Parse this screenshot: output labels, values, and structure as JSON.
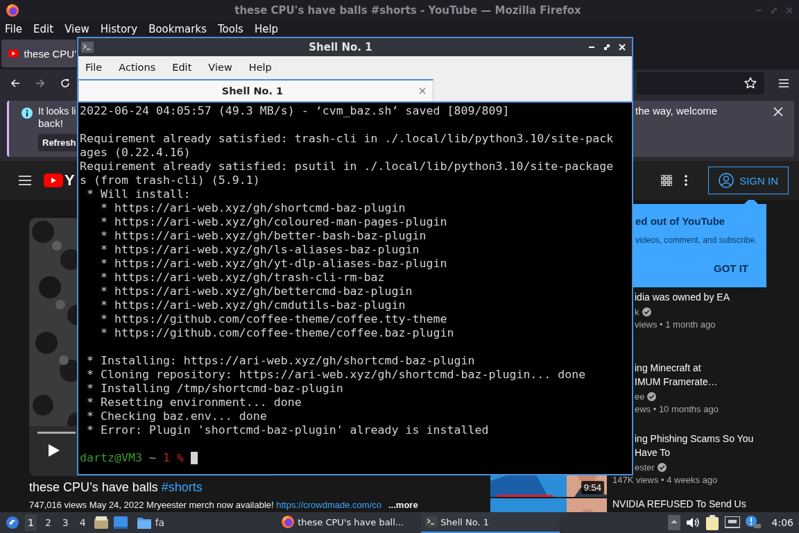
{
  "firefox": {
    "title": "these CPU's have balls #shorts - YouTube — Mozilla Firefox",
    "menu": [
      "File",
      "Edit",
      "View",
      "History",
      "Bookmarks",
      "Tools",
      "Help"
    ],
    "tab": {
      "label": "these CPU'",
      "selected": true
    },
    "notification": {
      "text_start": "It looks li",
      "text_end": "the way, welcome",
      "text_line2": "back!",
      "button": "Refresh"
    }
  },
  "youtube": {
    "logo_text": "Y",
    "sign_in": "SIGN IN",
    "popup": {
      "title": "ed out of YouTube",
      "body": "videos, comment, and subscribe.",
      "button": "GOT IT"
    },
    "video": {
      "kind": "picture",
      "progress": {
        "level": 0
      },
      "title": "these CPU’s have balls ",
      "hashtag": "#shorts",
      "description": "747,016 views  May 24, 2022  Mryeester merch now available! ",
      "link": "https://crowdmade.com/co",
      "more": "...more"
    },
    "related": [
      {
        "title_lines": [
          "idia was owned by EA"
        ],
        "channel": "k",
        "verified": true,
        "meta": "views • 1 month ago"
      },
      {
        "title_lines": [
          "ing Minecraft at",
          "IMUM Framerate…"
        ],
        "channel": "ee",
        "verified": true,
        "meta": "ews • 10 months ago"
      },
      {
        "title_lines": [
          "ing Phishing Scams So You",
          "Have To"
        ],
        "channel": "ester",
        "verified": true,
        "meta": "147K views • 4 weeks ago",
        "thumbnail": {
          "kind": "picture",
          "duration": "9:54"
        }
      },
      {
        "title_lines": [
          "NVIDIA REFUSED To Send Us"
        ],
        "thumbnail": {
          "kind": "picture"
        }
      }
    ]
  },
  "terminal": {
    "title": "Shell No. 1",
    "menu": [
      "File",
      "Actions",
      "Edit",
      "View",
      "Help"
    ],
    "tabs": [
      {
        "label": "Shell No. 1",
        "selected": true
      }
    ],
    "blocks": [
      [
        "2022-06-24 04:05:57 (49.3 MB/s) - ‘cvm_baz.sh’ saved [809/809]"
      ],
      [
        "Requirement already satisfied: trash-cli in ./.local/lib/python3.10/site-pack",
        "ages (0.22.4.16)",
        "Requirement already satisfied: psutil in ./.local/lib/python3.10/site-package",
        "s (from trash-cli) (5.9.1)",
        " * Will install:",
        "   * https://ari-web.xyz/gh/shortcmd-baz-plugin",
        "   * https://ari-web.xyz/gh/coloured-man-pages-plugin",
        "   * https://ari-web.xyz/gh/better-bash-baz-plugin",
        "   * https://ari-web.xyz/gh/ls-aliases-baz-plugin",
        "   * https://ari-web.xyz/gh/yt-dlp-aliases-baz-plugin",
        "   * https://ari-web.xyz/gh/trash-cli-rm-baz",
        "   * https://ari-web.xyz/gh/bettercmd-baz-plugin",
        "   * https://ari-web.xyz/gh/cmdutils-baz-plugin",
        "   * https://github.com/coffee-theme/coffee.tty-theme",
        "   * https://github.com/coffee-theme/coffee.baz-plugin"
      ],
      [
        " * Installing: https://ari-web.xyz/gh/shortcmd-baz-plugin",
        " * Cloning repository: https://ari-web.xyz/gh/shortcmd-baz-plugin... done",
        " * Installing /tmp/shortcmd-baz-plugin",
        " * Resetting environment... done",
        " * Checking baz.env... done",
        " * Error: Plugin 'shortcmd-baz-plugin' already is installed"
      ]
    ],
    "prompt": {
      "user_host": "dartz@VM3",
      "cwd": "~",
      "status": "1 %"
    }
  },
  "taskbar": {
    "workspaces": [
      {
        "label": "1",
        "selected": true
      },
      {
        "label": "2",
        "selected": false
      },
      {
        "label": "3",
        "selected": false
      },
      {
        "label": "4",
        "selected": false
      }
    ],
    "launchers": [
      {
        "kind": "files"
      },
      {
        "kind": "desktop"
      },
      {
        "kind": "folder",
        "label": "fa"
      }
    ],
    "tasks": [
      {
        "kind": "browser",
        "label": "these CPU's have ball...",
        "selected": false
      },
      {
        "kind": "terminal",
        "label": "Shell No. 1",
        "selected": true
      }
    ],
    "clock": "4:06"
  }
}
